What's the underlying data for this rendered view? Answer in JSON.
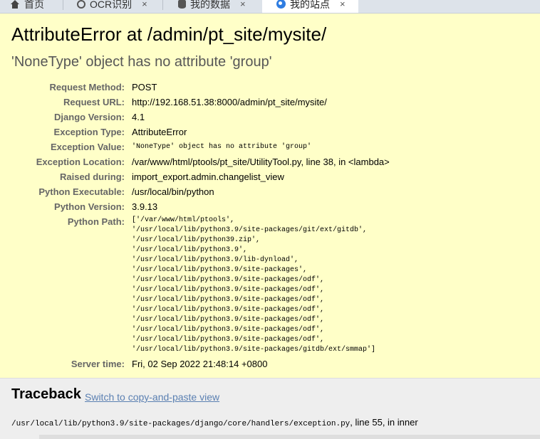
{
  "tabs": [
    {
      "label": "首页",
      "icon": "home-icon",
      "active": false
    },
    {
      "label": "OCR识别",
      "icon": "circle-icon",
      "active": false
    },
    {
      "label": "我的数据",
      "icon": "database-icon",
      "active": false
    },
    {
      "label": "我的站点",
      "icon": "globe-icon",
      "active": true
    }
  ],
  "tab_close": "×",
  "error": {
    "title": "AttributeError at /admin/pt_site/mysite/",
    "message": "'NoneType' object has no attribute 'group'"
  },
  "meta": {
    "request_method": {
      "label": "Request Method:",
      "value": "POST"
    },
    "request_url": {
      "label": "Request URL:",
      "value": "http://192.168.51.38:8000/admin/pt_site/mysite/"
    },
    "django_version": {
      "label": "Django Version:",
      "value": "4.1"
    },
    "exception_type": {
      "label": "Exception Type:",
      "value": "AttributeError"
    },
    "exception_value": {
      "label": "Exception Value:",
      "value": "'NoneType' object has no attribute 'group'"
    },
    "exception_location": {
      "label": "Exception Location:",
      "value": "/var/www/html/ptools/pt_site/UtilityTool.py, line 38, in <lambda>"
    },
    "raised_during": {
      "label": "Raised during:",
      "value": "import_export.admin.changelist_view"
    },
    "python_executable": {
      "label": "Python Executable:",
      "value": "/usr/local/bin/python"
    },
    "python_version": {
      "label": "Python Version:",
      "value": "3.9.13"
    },
    "python_path": {
      "label": "Python Path:"
    },
    "server_time": {
      "label": "Server time:",
      "value": "Fri, 02 Sep 2022 21:48:14 +0800"
    }
  },
  "python_path_lines": [
    "['/var/www/html/ptools',",
    " '/usr/local/lib/python3.9/site-packages/git/ext/gitdb',",
    " '/usr/local/lib/python39.zip',",
    " '/usr/local/lib/python3.9',",
    " '/usr/local/lib/python3.9/lib-dynload',",
    " '/usr/local/lib/python3.9/site-packages',",
    " '/usr/local/lib/python3.9/site-packages/odf',",
    " '/usr/local/lib/python3.9/site-packages/odf',",
    " '/usr/local/lib/python3.9/site-packages/odf',",
    " '/usr/local/lib/python3.9/site-packages/odf',",
    " '/usr/local/lib/python3.9/site-packages/odf',",
    " '/usr/local/lib/python3.9/site-packages/odf',",
    " '/usr/local/lib/python3.9/site-packages/odf',",
    " '/usr/local/lib/python3.9/site-packages/gitdb/ext/smmap']"
  ],
  "traceback": {
    "title": "Traceback",
    "switch_label": "Switch to copy-and-paste view",
    "frame_file": "/usr/local/lib/python3.9/site-packages/django/core/handlers/exception.py",
    "frame_suffix": ", line 55, in inner"
  }
}
